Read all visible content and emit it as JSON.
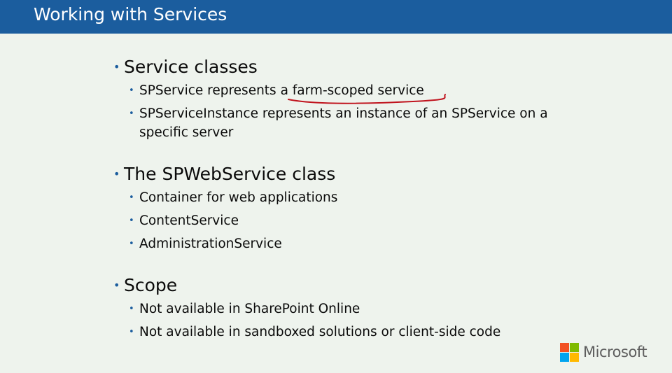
{
  "slide": {
    "title": "Working with Services",
    "sections": [
      {
        "heading": "Service classes",
        "items": [
          "SPService represents a farm-scoped service",
          "SPServiceInstance represents an instance of an SPService on a specific server"
        ]
      },
      {
        "heading": "The SPWebService class",
        "items": [
          "Container for web applications",
          "ContentService",
          "AdministrationService"
        ]
      },
      {
        "heading": "Scope",
        "items": [
          "Not available in SharePoint Online",
          "Not available in sandboxed solutions or client-side code"
        ]
      }
    ]
  },
  "annotation": {
    "color": "#c0141e"
  },
  "branding": {
    "logo_text": "Microsoft",
    "logo_colors": [
      "#f25022",
      "#7fba00",
      "#00a4ef",
      "#ffb900"
    ]
  },
  "colors": {
    "title_bar": "#1b5d9e",
    "background": "#eef3ed",
    "bullet": "#1b5d9e"
  }
}
